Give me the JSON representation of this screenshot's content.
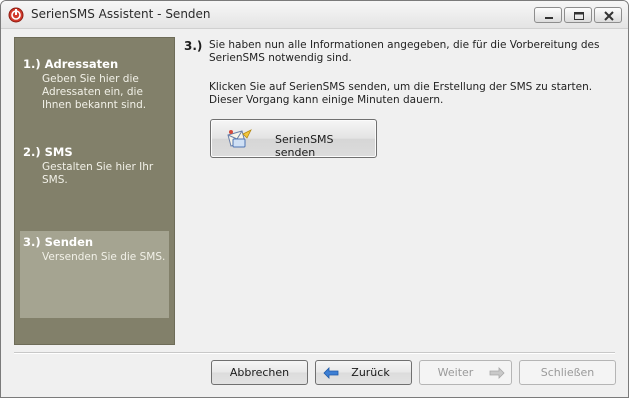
{
  "window": {
    "title": "SerienSMS Assistent - Senden"
  },
  "sidebar": {
    "steps": [
      {
        "title": "1.) Adressaten",
        "description": "Geben Sie hier die Adressaten ein, die Ihnen bekannt sind.",
        "active": false
      },
      {
        "title": "2.) SMS",
        "description": "Gestalten Sie hier Ihr SMS.",
        "active": false
      },
      {
        "title": "3.) Senden",
        "description": "Versenden Sie die SMS.",
        "active": true
      }
    ]
  },
  "content": {
    "step_number": "3.)",
    "intro": "Sie haben nun alle Informationen angegeben, die für die Vorbereitung des SerienSMS notwendig sind.",
    "instruction": "Klicken Sie auf SerienSMS senden, um die Erstellung der SMS zu starten. Dieser Vorgang kann einige Minuten dauern.",
    "send_button_label": "SerienSMS senden",
    "send_button_icon": "send-sms-icon"
  },
  "footer": {
    "cancel_label": "Abbrechen",
    "back_label": "Zurück",
    "next_label": "Weiter",
    "close_label": "Schließen",
    "next_enabled": false,
    "close_enabled": false
  },
  "colors": {
    "sidebar_bg": "#82806a",
    "sidebar_active_bg": "#a5a491",
    "window_bg": "#f0f0f0"
  }
}
